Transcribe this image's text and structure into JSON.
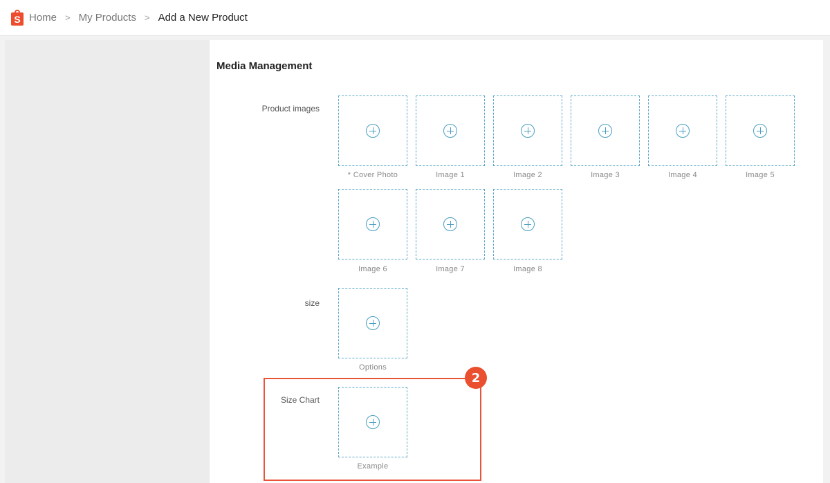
{
  "breadcrumb": {
    "logo_letter": "S",
    "items": [
      "Home",
      "My Products",
      "Add a New Product"
    ],
    "separator": ">"
  },
  "section": {
    "title": "Media Management"
  },
  "product_images": {
    "label": "Product images",
    "slots": [
      "* Cover Photo",
      "Image 1",
      "Image 2",
      "Image 3",
      "Image 4",
      "Image 5",
      "Image 6",
      "Image 7",
      "Image 8"
    ]
  },
  "size": {
    "label": "size",
    "slot": "Options"
  },
  "size_chart": {
    "label": "Size Chart",
    "slot": "Example"
  },
  "annotation": {
    "badge": "2",
    "color": "#ea4f2f"
  },
  "colors": {
    "brand": "#ee4d2d",
    "dashed_border": "#5aa8c8"
  }
}
